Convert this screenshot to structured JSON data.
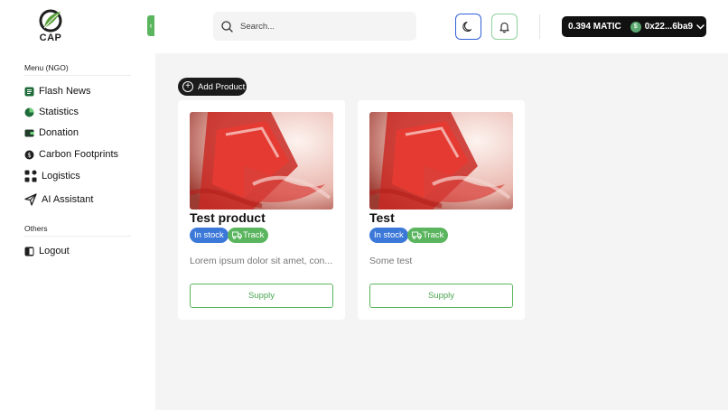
{
  "header": {
    "logo_text": "CAP",
    "search_placeholder": "Search...",
    "wallet": {
      "balance": "0.394 MATIC",
      "address": "0x22...6ba9"
    }
  },
  "sidebar": {
    "menu_title": "Menu (NGO)",
    "items": [
      {
        "label": "Flash News",
        "icon": "news-icon"
      },
      {
        "label": "Statistics",
        "icon": "pie-chart-icon"
      },
      {
        "label": "Donation",
        "icon": "wallet-icon"
      },
      {
        "label": "Carbon Footprints",
        "icon": "dollar-icon"
      },
      {
        "label": "Logistics",
        "icon": "grid-icon"
      },
      {
        "label": "AI Assistant",
        "icon": "send-icon"
      }
    ],
    "others_title": "Others",
    "others": [
      {
        "label": "Logout",
        "icon": "logout-icon"
      }
    ]
  },
  "main": {
    "add_product_label": "Add Product",
    "products": [
      {
        "title": "Test product",
        "stock": "In stock",
        "track": "Track",
        "description": "Lorem ipsum dolor sit amet, con...",
        "action": "Supply"
      },
      {
        "title": "Test",
        "stock": "In stock",
        "track": "Track",
        "description": "Some test",
        "action": "Supply"
      }
    ]
  },
  "colors": {
    "accent_green": "#5bb55f",
    "accent_blue": "#3b78d8",
    "wallet_bg": "#111111"
  }
}
